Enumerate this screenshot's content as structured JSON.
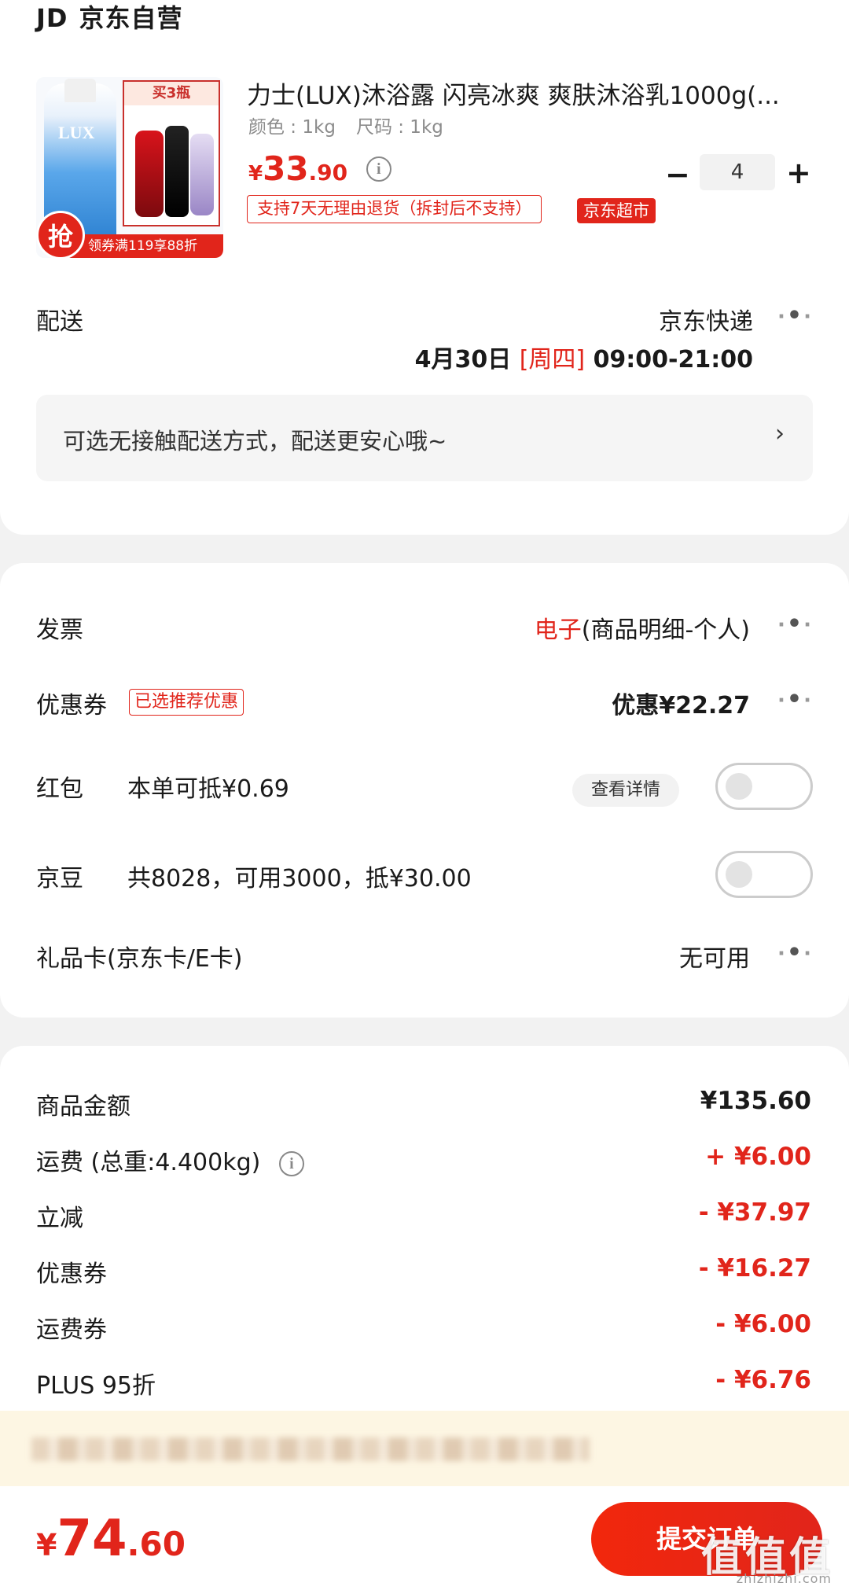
{
  "store": {
    "logo": "JD",
    "name": "京东自营"
  },
  "product": {
    "image_alt": "LUX shower gel product image",
    "image_promo_text": "买3瓶",
    "image_badge": "抢",
    "image_coupon": "领券满119享88折",
    "title": "力士(LUX)沐浴露 闪亮冰爽 爽肤沐浴乳1000g(...",
    "color_label": "颜色 : 1kg",
    "size_label": "尺码 : 1kg",
    "price_symbol": "¥",
    "price_int": "33",
    "price_dec": ".90",
    "quantity": "4",
    "minus": "−",
    "plus": "+",
    "return_policy": "支持7天无理由退货（拆封后不支持）",
    "market_tag": "京东超市"
  },
  "delivery": {
    "label": "配送",
    "method": "京东快递",
    "date": "4月30日",
    "weekday": "[周四]",
    "time": "09:00-21:00",
    "contactless": "可选无接触配送方式，配送更安心哦~",
    "chevron": "›"
  },
  "options": {
    "invoice": {
      "label": "发票",
      "type": "电子",
      "detail": "(商品明细-个人)"
    },
    "coupon": {
      "label": "优惠券",
      "tag": "已选推荐优惠",
      "value": "优惠¥22.27"
    },
    "red_packet": {
      "label": "红包",
      "desc": "本单可抵¥0.69",
      "detail_btn": "查看详情",
      "enabled": false
    },
    "jingdou": {
      "label": "京豆",
      "desc": "共8028，可用3000，抵¥30.00",
      "enabled": false
    },
    "gift_card": {
      "label": "礼品卡(京东卡/E卡)",
      "value": "无可用"
    }
  },
  "summary": {
    "rows": [
      {
        "label": "商品金额",
        "value": "¥135.60"
      },
      {
        "label": "运费  (总重:4.400kg)",
        "value": "+ ¥6.00"
      },
      {
        "label": "立减",
        "value": "- ¥37.97"
      },
      {
        "label": "优惠券",
        "value": "- ¥16.27"
      },
      {
        "label": "运费券",
        "value": "- ¥6.00"
      },
      {
        "label": "PLUS 95折",
        "value": "- ¥6.76"
      }
    ]
  },
  "footer": {
    "total_symbol": "¥",
    "total_int": "74",
    "total_dec": ".60",
    "submit": "提交订单",
    "watermark": "值值值",
    "watermark_sub": "zhizhizhi.com"
  },
  "colors": {
    "accent": "#e1251b",
    "background": "#f2f2f2",
    "banner": "#fdf6e3"
  }
}
